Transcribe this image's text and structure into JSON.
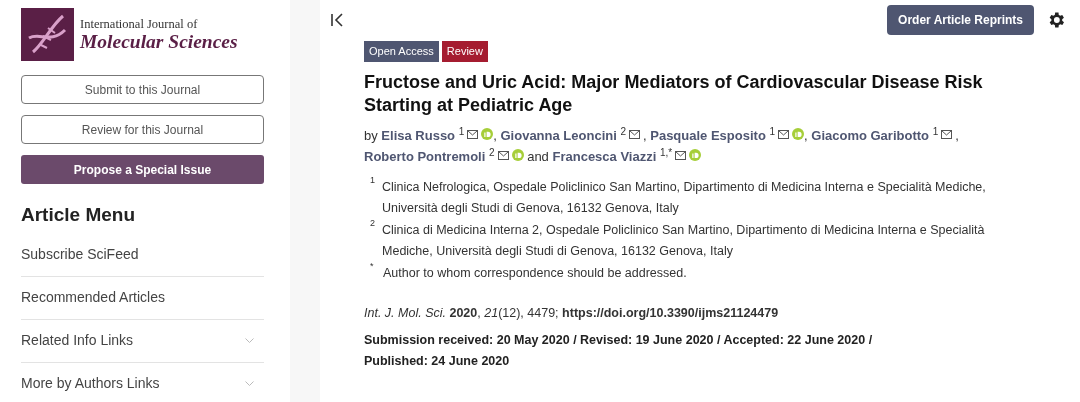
{
  "journal": {
    "line_1": "International Journal of",
    "line_2": "Molecular Sciences"
  },
  "sidebar_buttons": [
    {
      "label": "Submit to this Journal",
      "kind": "outline"
    },
    {
      "label": "Review for this Journal",
      "kind": "outline"
    },
    {
      "label": "Propose a Special Issue",
      "kind": "filled"
    }
  ],
  "article_menu": {
    "title": "Article Menu",
    "items": [
      {
        "label": "Subscribe SciFeed",
        "expandable": false
      },
      {
        "label": "Recommended Articles",
        "expandable": false
      },
      {
        "label": "Related Info Links",
        "expandable": true
      },
      {
        "label": "More by Authors Links",
        "expandable": true
      }
    ]
  },
  "header": {
    "reprints_button": "Order Article Reprints"
  },
  "badges": [
    {
      "label": "Open Access",
      "color": "#4f5671"
    },
    {
      "label": "Review",
      "color": "#a51c30"
    }
  ],
  "title": "Fructose and Uric Acid: Major Mediators of Cardiovascular Disease Risk Starting at Pediatric Age",
  "authors_prefix": "by",
  "authors": [
    {
      "name": "Elisa Russo",
      "affiliation": "1",
      "orcid": true,
      "separator": ","
    },
    {
      "name": "Giovanna Leoncini",
      "affiliation": "2",
      "orcid": false,
      "separator": ","
    },
    {
      "name": "Pasquale Esposito",
      "affiliation": "1",
      "orcid": true,
      "separator": ","
    },
    {
      "name": "Giacomo Garibotto",
      "affiliation": "1",
      "orcid": false,
      "separator": ","
    },
    {
      "name": "Roberto Pontremoli",
      "affiliation": "2",
      "orcid": true
    },
    {
      "name": "Francesca Viazzi",
      "affiliation": "1,*",
      "orcid": true
    }
  ],
  "authors_last_joiner": "and",
  "affiliations": [
    {
      "mark": "1",
      "text": "Clinica Nefrologica, Ospedale Policlinico San Martino, Dipartimento di Medicina Interna e Specialità Mediche, Università degli Studi di Genova, 16132 Genova, Italy"
    },
    {
      "mark": "2",
      "text": "Clinica di Medicina Interna 2, Ospedale Policlinico San Martino, Dipartimento di Medicina Interna e Specialità Mediche, Università degli Studi di Genova, 16132 Genova, Italy"
    },
    {
      "mark": "*",
      "text": "Author to whom correspondence should be addressed."
    }
  ],
  "citation": {
    "text": "*Int. J. Mol. Sci.* **2020**, *21*(12), 4479;",
    "doi": "https://doi.org/10.3390/ijms21124479"
  },
  "dates": [
    "Submission received: 20 May 2020 / Revised: 19 June 2020 / Accepted: 22 June 2020 /",
    "Published: 24 June 2020"
  ]
}
